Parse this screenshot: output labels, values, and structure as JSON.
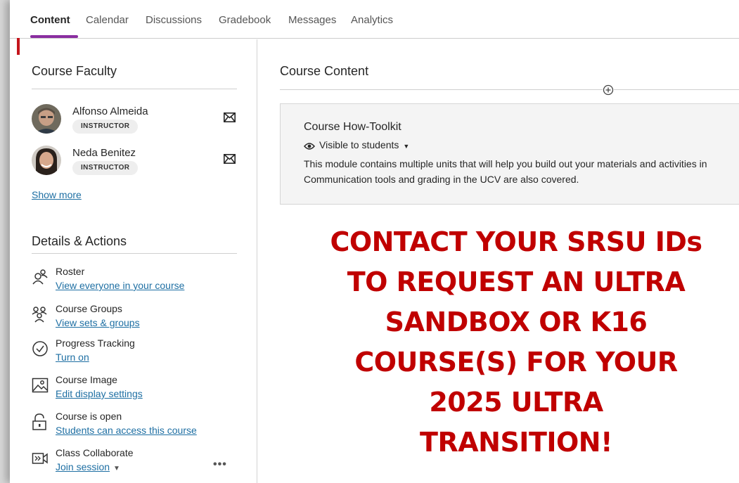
{
  "nav": {
    "tabs": [
      {
        "label": "Content",
        "active": true
      },
      {
        "label": "Calendar"
      },
      {
        "label": "Discussions"
      },
      {
        "label": "Gradebook"
      },
      {
        "label": "Messages"
      },
      {
        "label": "Analytics"
      }
    ]
  },
  "faculty": {
    "title": "Course Faculty",
    "members": [
      {
        "name": "Alfonso Almeida",
        "role": "INSTRUCTOR"
      },
      {
        "name": "Neda Benitez",
        "role": "INSTRUCTOR"
      }
    ],
    "show_more": "Show more"
  },
  "details": {
    "title": "Details & Actions",
    "items": [
      {
        "title": "Roster",
        "link": "View everyone in your course",
        "icon": "roster-icon"
      },
      {
        "title": "Course Groups",
        "link": "View sets & groups",
        "icon": "groups-icon"
      },
      {
        "title": "Progress Tracking",
        "link": "Turn on",
        "icon": "check-circle-icon"
      },
      {
        "title": "Course Image",
        "link": "Edit display settings",
        "icon": "image-icon"
      },
      {
        "title": "Course is open",
        "link": "Students can access this course",
        "icon": "unlock-icon"
      },
      {
        "title": "Class Collaborate",
        "link": "Join session",
        "icon": "collaborate-icon"
      }
    ],
    "more": "•••"
  },
  "content": {
    "title": "Course Content",
    "module": {
      "title": "Course How-Toolkit",
      "visibility": "Visible to students",
      "description_line1": "This module contains multiple units that will help you build out your materials and activities in",
      "description_line2": "Communication tools and grading in the UCV are also covered."
    }
  },
  "callout": {
    "lines": [
      "CONTACT YOUR SRSU IDs",
      "TO REQUEST AN ULTRA",
      "SANDBOX OR K16",
      "COURSE(S) FOR YOUR",
      "2025 ULTRA",
      "TRANSITION!"
    ],
    "color": "#c00000"
  },
  "colors": {
    "accent": "#8a2ea0",
    "link": "#1e6fa3",
    "marker": "#c4151c"
  }
}
